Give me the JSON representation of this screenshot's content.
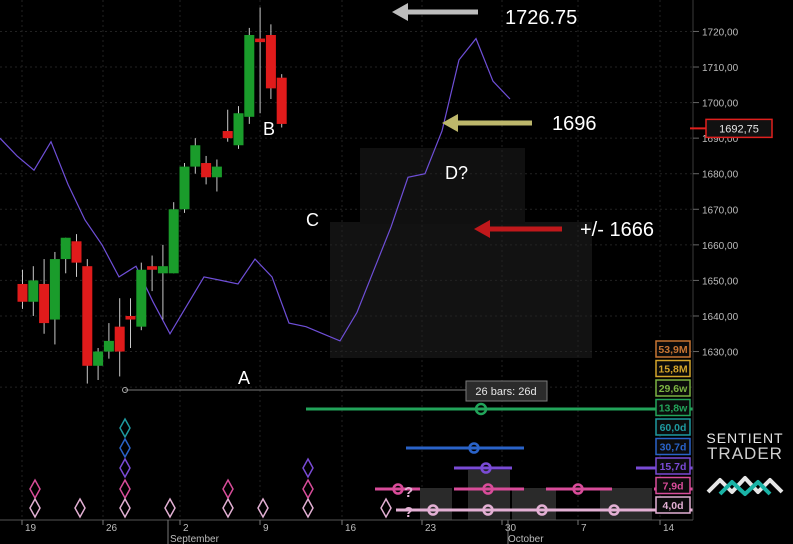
{
  "chart_data": {
    "type": "candlestick",
    "y_axis": {
      "range": [
        1622,
        1728
      ],
      "ticks": [
        "1720,00",
        "1710,00",
        "1700,00",
        "1690,00",
        "1680,00",
        "1670,00",
        "1660,00",
        "1650,00",
        "1640,00",
        "1630,00"
      ]
    },
    "current_price": "1692,75",
    "x_axis": {
      "day_labels": [
        "19",
        "26",
        "2",
        "9",
        "16",
        "23",
        "30",
        "7",
        "14"
      ],
      "month_labels": [
        "September",
        "October"
      ]
    },
    "candles": [
      {
        "o": 1649.0,
        "h": 1653.0,
        "l": 1642.0,
        "c": 1644.0
      },
      {
        "o": 1644.0,
        "h": 1654.0,
        "l": 1640.0,
        "c": 1650.0
      },
      {
        "o": 1649.0,
        "h": 1656.0,
        "l": 1635.0,
        "c": 1638.0
      },
      {
        "o": 1639.0,
        "h": 1658.0,
        "l": 1632.0,
        "c": 1656.0
      },
      {
        "o": 1656.0,
        "h": 1662.0,
        "l": 1652.0,
        "c": 1662.0
      },
      {
        "o": 1661.0,
        "h": 1663.0,
        "l": 1651.0,
        "c": 1655.0
      },
      {
        "o": 1654.0,
        "h": 1656.0,
        "l": 1621.0,
        "c": 1626.0
      },
      {
        "o": 1626.0,
        "h": 1631.0,
        "l": 1622.0,
        "c": 1630.0
      },
      {
        "o": 1630.0,
        "h": 1638.0,
        "l": 1628.0,
        "c": 1633.0
      },
      {
        "o": 1637.0,
        "h": 1645.0,
        "l": 1623.0,
        "c": 1630.0
      },
      {
        "o": 1640.0,
        "h": 1645.0,
        "l": 1631.0,
        "c": 1639.0
      },
      {
        "o": 1637.0,
        "h": 1655.0,
        "l": 1636.0,
        "c": 1653.0
      },
      {
        "o": 1654.0,
        "h": 1657.0,
        "l": 1647.0,
        "c": 1653.0
      },
      {
        "o": 1652.0,
        "h": 1660.0,
        "l": 1639.0,
        "c": 1654.0
      },
      {
        "o": 1652.0,
        "h": 1672.0,
        "l": 1652.0,
        "c": 1670.0
      },
      {
        "o": 1670.0,
        "h": 1683.0,
        "l": 1669.0,
        "c": 1682.0
      },
      {
        "o": 1682.0,
        "h": 1690.0,
        "l": 1680.0,
        "c": 1688.0
      },
      {
        "o": 1683.0,
        "h": 1685.0,
        "l": 1677.0,
        "c": 1679.0
      },
      {
        "o": 1679.0,
        "h": 1684.0,
        "l": 1675.0,
        "c": 1682.0
      },
      {
        "o": 1692.0,
        "h": 1698.0,
        "l": 1689.0,
        "c": 1690.0
      },
      {
        "o": 1688.0,
        "h": 1699.0,
        "l": 1687.0,
        "c": 1697.0
      },
      {
        "o": 1696.0,
        "h": 1721.0,
        "l": 1694.0,
        "c": 1719.0
      },
      {
        "o": 1718.0,
        "h": 1726.75,
        "l": 1697.0,
        "c": 1717.0
      },
      {
        "o": 1719.0,
        "h": 1722.0,
        "l": 1701.0,
        "c": 1704.0
      },
      {
        "o": 1707.0,
        "h": 1708.0,
        "l": 1693.0,
        "c": 1694.0
      }
    ],
    "cycle_line": [
      1690.0,
      1685.0,
      1681.0,
      1689.0,
      1677.0,
      1667.0,
      1660.0,
      1651.0,
      1654.0,
      1644.0,
      1635.0,
      1643.0,
      1651.0,
      1650.0,
      1649.0,
      1656.0,
      1651.0,
      1638.0,
      1637.0,
      1635.0,
      1633.0,
      1641.0,
      1653.0,
      1665.0,
      1679.0,
      1680.0,
      1692.0,
      1712.0,
      1718.0,
      1706.0,
      1701.0
    ],
    "wave_labels": [
      "A",
      "B",
      "C",
      "D?"
    ],
    "annotations": [
      {
        "text": "1726.75",
        "color": "#bdbdbd"
      },
      {
        "text": "1696",
        "color": "#bdb76b"
      },
      {
        "text": "+/- 1666",
        "color": "#c0181b"
      }
    ],
    "measure_label": "26 bars: 26d",
    "cycle_periods": [
      {
        "label": "53,9M",
        "color": "#c87533",
        "pct": 90
      },
      {
        "label": "15,8M",
        "color": "#d4a52a",
        "pct": 90
      },
      {
        "label": "29,6w",
        "color": "#7cb342",
        "pct": 90
      },
      {
        "label": "13,8w",
        "color": "#22a45a",
        "pct": 90
      },
      {
        "label": "60,0d",
        "color": "#1e9aa0",
        "pct": 90
      },
      {
        "label": "30,7d",
        "color": "#2a63c9",
        "pct": 90
      },
      {
        "label": "15,7d",
        "color": "#7a4bd6",
        "pct": 90
      },
      {
        "label": "7,9d",
        "color": "#d94c9a",
        "pct": 90
      },
      {
        "label": "4,0d",
        "color": "#e3b0d4",
        "pct": 90
      }
    ],
    "question_marks": [
      "?",
      "?"
    ]
  },
  "brand": {
    "line1": "SENTIENT",
    "line2": "TRADER"
  }
}
